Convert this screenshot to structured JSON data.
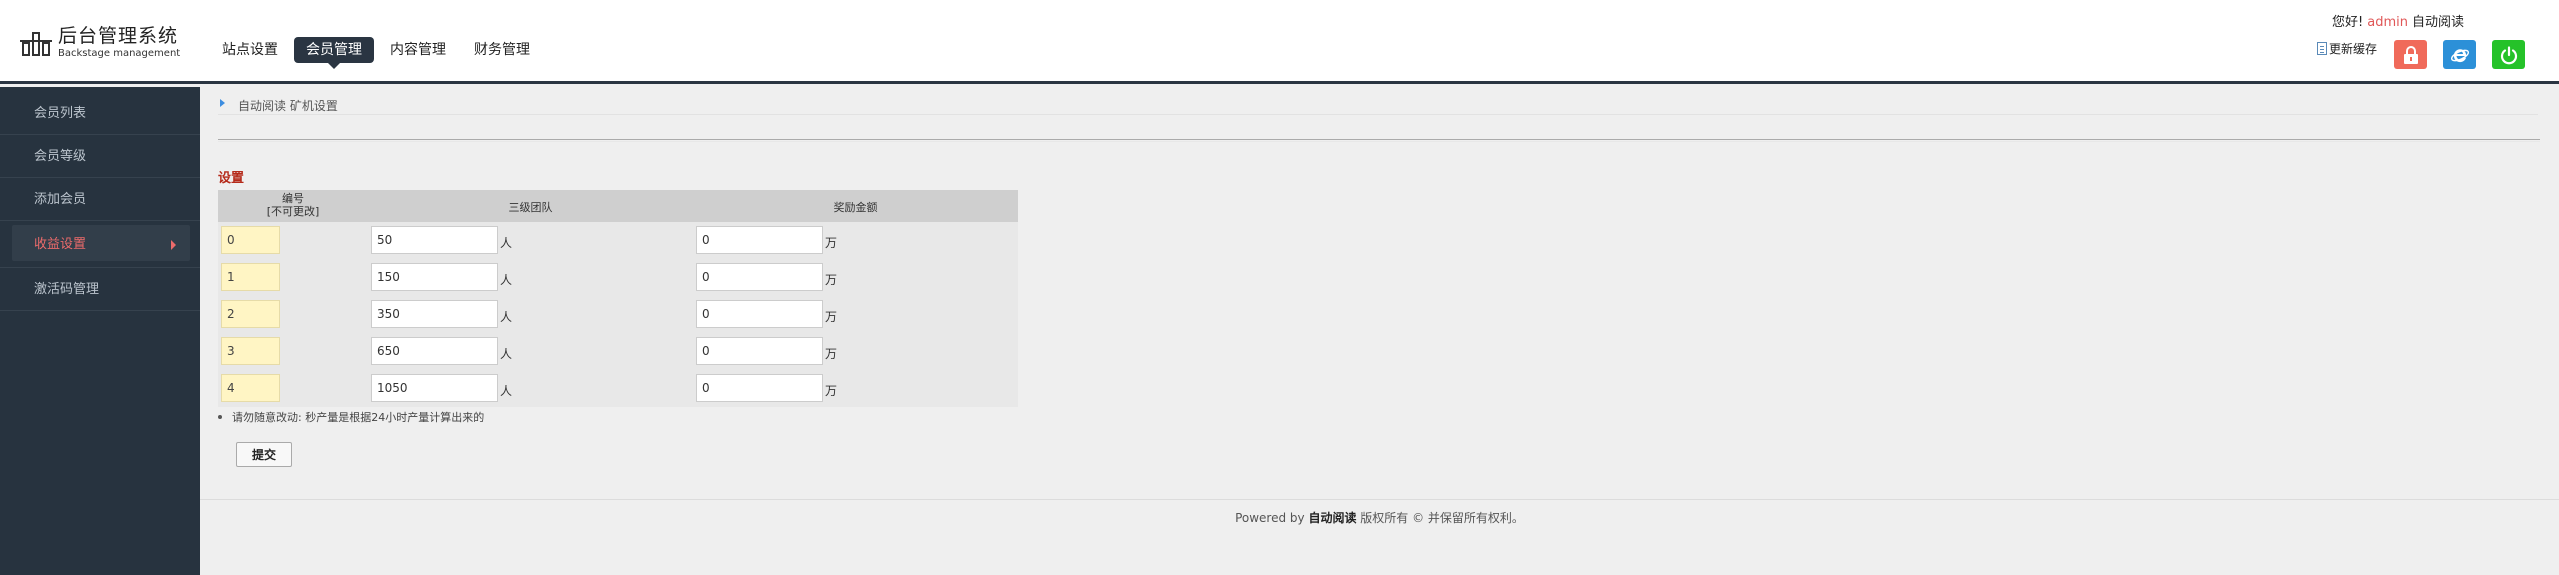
{
  "header": {
    "logo_title": "后台管理系统",
    "logo_subtitle": "Backstage management",
    "nav": [
      {
        "label": "站点设置",
        "active": false
      },
      {
        "label": "会员管理",
        "active": true
      },
      {
        "label": "内容管理",
        "active": false
      },
      {
        "label": "财务管理",
        "active": false
      }
    ],
    "greeting": "您好!",
    "username": "admin",
    "site_name": "自动阅读",
    "refresh_label": "更新缓存",
    "buttons": [
      "lock-icon",
      "ie-icon",
      "power-icon"
    ],
    "colors": {
      "lock": "#f06a5a",
      "ie": "#2c90d8",
      "power": "#25c229",
      "dark": "#2a3542"
    }
  },
  "sidebar": {
    "items": [
      {
        "label": "会员列表",
        "active": false
      },
      {
        "label": "会员等级",
        "active": false
      },
      {
        "label": "添加会员",
        "active": false
      },
      {
        "label": "收益设置",
        "active": true
      },
      {
        "label": "激活码管理",
        "active": false
      }
    ]
  },
  "main": {
    "breadcrumb": "自动阅读 矿机设置",
    "section_title": "设置",
    "table": {
      "headers": {
        "id_line1": "编号",
        "id_line2": "[不可更改]",
        "team": "三级团队",
        "reward": "奖励金额"
      },
      "rows": [
        {
          "id": "0",
          "team": "50",
          "team_unit": "人",
          "reward": "0",
          "reward_unit": "万"
        },
        {
          "id": "1",
          "team": "150",
          "team_unit": "人",
          "reward": "0",
          "reward_unit": "万"
        },
        {
          "id": "2",
          "team": "350",
          "team_unit": "人",
          "reward": "0",
          "reward_unit": "万"
        },
        {
          "id": "3",
          "team": "650",
          "team_unit": "人",
          "reward": "0",
          "reward_unit": "万"
        },
        {
          "id": "4",
          "team": "1050",
          "team_unit": "人",
          "reward": "0",
          "reward_unit": "万"
        }
      ]
    },
    "note": "请勿随意改动: 秒产量是根据24小时产量计算出来的",
    "submit_label": "提交"
  },
  "footer": {
    "prefix": "Powered by",
    "brand": "自动阅读",
    "suffix": "版权所有 © 并保留所有权利。"
  }
}
